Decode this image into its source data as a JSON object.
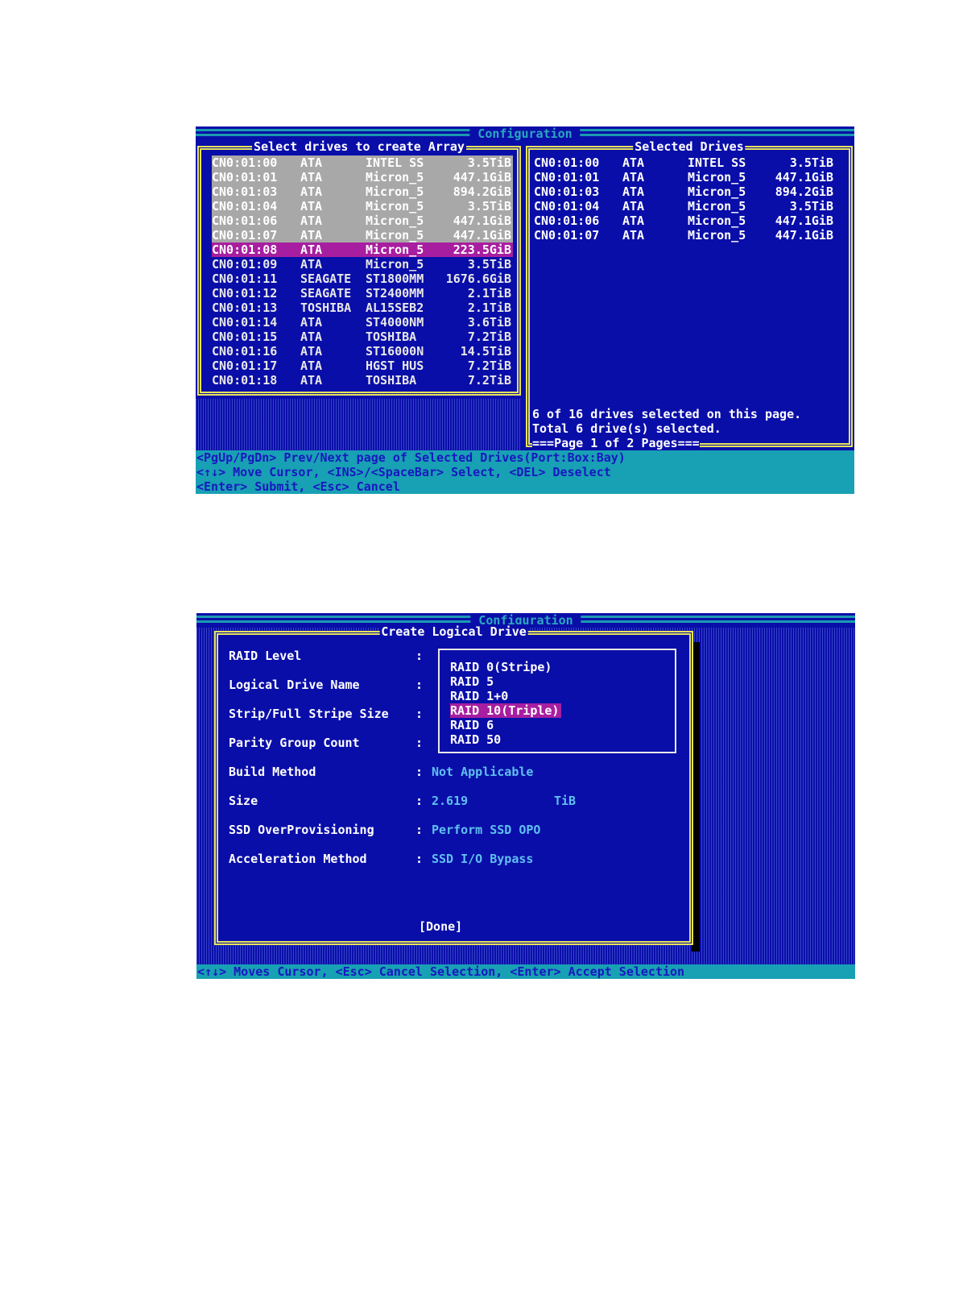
{
  "screen1": {
    "title": "Configuration",
    "left_panel": {
      "title": "Select drives to create Array",
      "drives": [
        {
          "id": "CN0:01:00",
          "vendor": "ATA",
          "model": "INTEL SS",
          "size": "3.5TiB",
          "state": "selected"
        },
        {
          "id": "CN0:01:01",
          "vendor": "ATA",
          "model": "Micron_5",
          "size": "447.1GiB",
          "state": "selected"
        },
        {
          "id": "CN0:01:03",
          "vendor": "ATA",
          "model": "Micron_5",
          "size": "894.2GiB",
          "state": "selected"
        },
        {
          "id": "CN0:01:04",
          "vendor": "ATA",
          "model": "Micron_5",
          "size": "3.5TiB",
          "state": "selected"
        },
        {
          "id": "CN0:01:06",
          "vendor": "ATA",
          "model": "Micron_5",
          "size": "447.1GiB",
          "state": "selected"
        },
        {
          "id": "CN0:01:07",
          "vendor": "ATA",
          "model": "Micron_5",
          "size": "447.1GiB",
          "state": "selected"
        },
        {
          "id": "CN0:01:08",
          "vendor": "ATA",
          "model": "Micron_5",
          "size": "223.5GiB",
          "state": "cursor"
        },
        {
          "id": "CN0:01:09",
          "vendor": "ATA",
          "model": "Micron_5",
          "size": "3.5TiB",
          "state": "none"
        },
        {
          "id": "CN0:01:11",
          "vendor": "SEAGATE",
          "model": "ST1800MM",
          "size": "1676.6GiB",
          "state": "none"
        },
        {
          "id": "CN0:01:12",
          "vendor": "SEAGATE",
          "model": "ST2400MM",
          "size": "2.1TiB",
          "state": "none"
        },
        {
          "id": "CN0:01:13",
          "vendor": "TOSHIBA",
          "model": "AL15SEB2",
          "size": "2.1TiB",
          "state": "none"
        },
        {
          "id": "CN0:01:14",
          "vendor": "ATA",
          "model": "ST4000NM",
          "size": "3.6TiB",
          "state": "none"
        },
        {
          "id": "CN0:01:15",
          "vendor": "ATA",
          "model": "TOSHIBA",
          "size": "7.2TiB",
          "state": "none"
        },
        {
          "id": "CN0:01:16",
          "vendor": "ATA",
          "model": "ST16000N",
          "size": "14.5TiB",
          "state": "none"
        },
        {
          "id": "CN0:01:17",
          "vendor": "ATA",
          "model": "HGST HUS",
          "size": "7.2TiB",
          "state": "none"
        },
        {
          "id": "CN0:01:18",
          "vendor": "ATA",
          "model": "TOSHIBA",
          "size": "7.2TiB",
          "state": "none"
        }
      ]
    },
    "right_panel": {
      "title": "Selected Drives",
      "drives": [
        {
          "id": "CN0:01:00",
          "vendor": "ATA",
          "model": "INTEL SS",
          "size": "3.5TiB"
        },
        {
          "id": "CN0:01:01",
          "vendor": "ATA",
          "model": "Micron_5",
          "size": "447.1GiB"
        },
        {
          "id": "CN0:01:03",
          "vendor": "ATA",
          "model": "Micron_5",
          "size": "894.2GiB"
        },
        {
          "id": "CN0:01:04",
          "vendor": "ATA",
          "model": "Micron_5",
          "size": "3.5TiB"
        },
        {
          "id": "CN0:01:06",
          "vendor": "ATA",
          "model": "Micron_5",
          "size": "447.1GiB"
        },
        {
          "id": "CN0:01:07",
          "vendor": "ATA",
          "model": "Micron_5",
          "size": "447.1GiB"
        }
      ],
      "status_line1": "6 of 16 drives selected on this page.",
      "status_line2": "Total 6 drive(s) selected.",
      "page_indicator": "===Page 1 of 2 Pages==="
    },
    "help_lines": [
      "<PgUp/PgDn> Prev/Next page of Selected Drives(Port:Box:Bay)",
      "<↑↓> Move Cursor, <INS>/<SpaceBar> Select, <DEL> Deselect",
      "<Enter> Submit, <Esc> Cancel"
    ]
  },
  "screen2": {
    "title": "Configuration",
    "dialog_title": "Create Logical Drive",
    "fields": [
      {
        "label": "RAID Level",
        "value": ""
      },
      {
        "label": "Logical Drive Name",
        "value": ""
      },
      {
        "label": "Strip/Full Stripe Size",
        "value": ""
      },
      {
        "label": "Parity Group Count",
        "value": ""
      },
      {
        "label": "Build Method",
        "value": "Not Applicable"
      },
      {
        "label": "Size",
        "value": "2.619",
        "unit": "TiB"
      },
      {
        "label": "SSD OverProvisioning",
        "value": "Perform SSD OPO"
      },
      {
        "label": "Acceleration Method",
        "value": "SSD I/O Bypass"
      }
    ],
    "raid_options": [
      "RAID 0(Stripe)",
      "RAID 5",
      "RAID 1+0",
      "RAID 10(Triple)",
      "RAID 6",
      "RAID 50"
    ],
    "raid_highlighted": "RAID 10(Triple)",
    "done_button": "[Done]",
    "help_line": "<↑↓> Moves Cursor, <Esc> Cancel Selection, <Enter> Accept Selection",
    "colon": ":"
  }
}
